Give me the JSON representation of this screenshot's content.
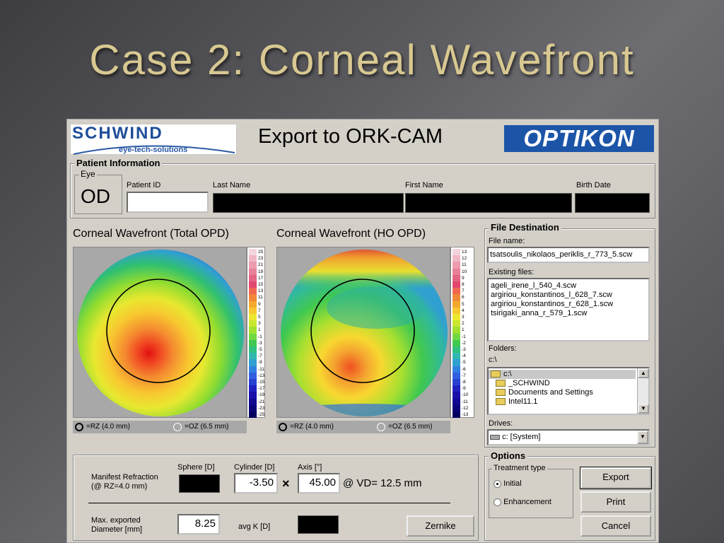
{
  "slide": {
    "title": "Case 2: Corneal Wavefront"
  },
  "dialog": {
    "schwind_logo": "SCHWIND",
    "schwind_tagline": "eye-tech-solutions",
    "title": "Export to ORK-CAM",
    "optikon_logo": "OPTIKON"
  },
  "patient": {
    "group_label": "Patient Information",
    "eye_label": "Eye",
    "eye_value": "OD",
    "patient_id_label": "Patient ID",
    "patient_id_value": "",
    "last_name_label": "Last Name",
    "first_name_label": "First Name",
    "birth_date_label": "Birth Date"
  },
  "maps": {
    "total": {
      "title": "Corneal Wavefront (Total OPD)",
      "scale": [
        "25",
        "23",
        "21",
        "19",
        "17",
        "15",
        "13",
        "11",
        "9",
        "7",
        "5",
        "3",
        "1",
        "-1",
        "-3",
        "-5",
        "-7",
        "-9",
        "-11",
        "-13",
        "-15",
        "-17",
        "-19",
        "-21",
        "-23",
        "-25"
      ],
      "rz_label": "=RZ (4.0 mm)",
      "oz_label": "=OZ (6.5 mm)"
    },
    "ho": {
      "title": "Corneal Wavefront (HO OPD)",
      "scale": [
        "13",
        "12",
        "11",
        "10",
        "9",
        "8",
        "7",
        "6",
        "5",
        "4",
        "3",
        "2",
        "1",
        "-1",
        "-2",
        "-3",
        "-4",
        "-5",
        "-6",
        "-7",
        "-8",
        "-9",
        "-10",
        "-11",
        "-12",
        "-13"
      ],
      "rz_label": "=RZ (4.0 mm)",
      "oz_label": "=OZ (6.5 mm)"
    },
    "scale_colors": [
      "#f4d4dc",
      "#f0b8c4",
      "#ec9cae",
      "#e88098",
      "#e46484",
      "#e04870",
      "#f06850",
      "#f08838",
      "#f4a830",
      "#f8c830",
      "#ece830",
      "#c8e830",
      "#a0e030",
      "#70d840",
      "#40c850",
      "#30c080",
      "#30b8b0",
      "#30a0d0",
      "#3080e0",
      "#3060e0",
      "#2840d0",
      "#2020c0",
      "#1810a8",
      "#100890",
      "#080478",
      "#040060"
    ]
  },
  "refraction": {
    "manifest_label": "Manifest Refraction",
    "manifest_sub": "(@ RZ=4.0 mm)",
    "sphere_label": "Sphere [D]",
    "cylinder_label": "Cylinder [D]",
    "axis_label": "Axis [°]",
    "cylinder_value": "-3.50",
    "axis_value": "45.00",
    "times_symbol": "×",
    "vd_text": "@ VD= 12.5 mm",
    "max_exported_label": "Max. exported",
    "diameter_label": "Diameter [mm]",
    "diameter_value": "8.25",
    "avgk_label": "avg K [D]",
    "zernike_button": "Zernike"
  },
  "file_destination": {
    "group_label": "File Destination",
    "file_name_label": "File name:",
    "file_name_value": "tsatsoulis_nikolaos_periklis_r_773_5.scw",
    "existing_label": "Existing files:",
    "existing_files": [
      "ageli_irene_l_540_4.scw",
      "argiriou_konstantinos_l_628_7.scw",
      "argiriou_konstantinos_r_628_1.scw",
      "tsirigaki_anna_r_579_1.scw"
    ],
    "folders_label": "Folders:",
    "folders_path": "c:\\",
    "folders": [
      "c:\\",
      "_SCHWIND",
      "Documents and Settings",
      "Intel11.1"
    ],
    "drives_label": "Drives:",
    "drive_value": "c: [System]"
  },
  "options": {
    "group_label": "Options",
    "treatment_label": "Treatment type",
    "initial_label": "Initial",
    "enhancement_label": "Enhancement",
    "selected": "Initial",
    "export_button": "Export",
    "print_button": "Print",
    "cancel_button": "Cancel"
  }
}
